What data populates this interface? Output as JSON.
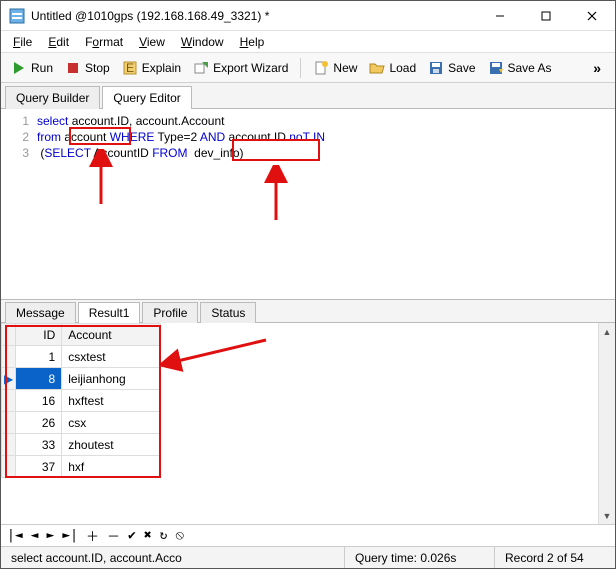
{
  "title": "Untitled @1010gps (192.168.168.49_3321) *",
  "menu": {
    "file": "File",
    "edit": "Edit",
    "format": "Format",
    "view": "View",
    "window": "Window",
    "help": "Help"
  },
  "toolbar": {
    "run": "Run",
    "stop": "Stop",
    "explain": "Explain",
    "export": "Export Wizard",
    "new": "New",
    "load": "Load",
    "save": "Save",
    "saveas": "Save As"
  },
  "tabs": {
    "builder": "Query Builder",
    "editor": "Query Editor"
  },
  "sql": {
    "l1a": "select",
    "l1b": " account.ID, account.Account",
    "l2a": "from",
    "l2b": " account ",
    "l2c": "WHERE",
    "l2d": " Type=2 ",
    "l2e": "AND",
    "l2f": " account.ID ",
    "l2g": "noT IN",
    "l3a": " (",
    "l3b": "SELECT",
    "l3c": " AccountID ",
    "l3d": "FROM",
    "l3e": "  dev_info)"
  },
  "lower_tabs": {
    "message": "Message",
    "result": "Result1",
    "profile": "Profile",
    "status": "Status"
  },
  "grid": {
    "cols": {
      "id": "ID",
      "account": "Account"
    },
    "rows": [
      {
        "id": "1",
        "acc": "csxtest"
      },
      {
        "id": "8",
        "acc": "leijianhong"
      },
      {
        "id": "16",
        "acc": "hxftest"
      },
      {
        "id": "26",
        "acc": "csx"
      },
      {
        "id": "33",
        "acc": "zhoutest"
      },
      {
        "id": "37",
        "acc": "hxf"
      }
    ]
  },
  "status": {
    "sql": "select account.ID, account.Acco",
    "time": "Query time: 0.026s",
    "record": "Record 2 of 54"
  }
}
